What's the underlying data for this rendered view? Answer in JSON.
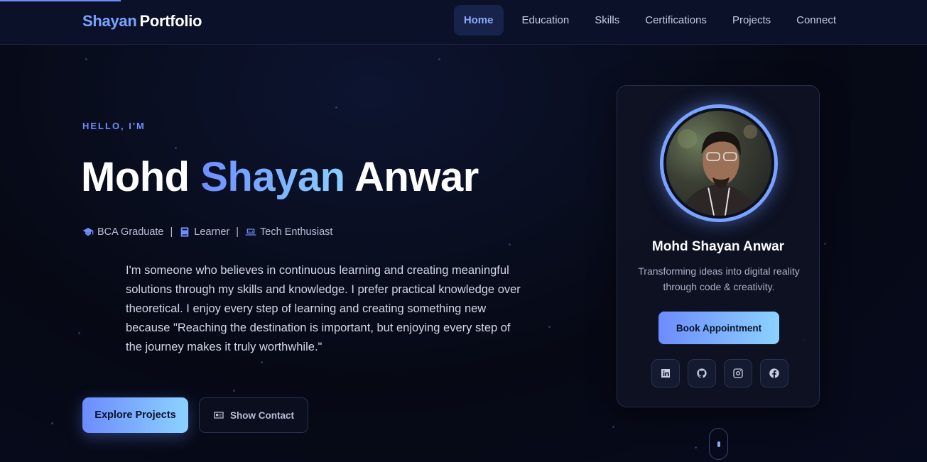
{
  "nav": {
    "logo_first": "Shayan",
    "logo_second": "Portfolio",
    "links": [
      "Home",
      "Education",
      "Skills",
      "Certifications",
      "Projects",
      "Connect"
    ],
    "active": "Home"
  },
  "hero": {
    "greeting": "HELLO, I'M",
    "name_first": "Mohd",
    "name_middle": "Shayan",
    "name_last": "Anwar",
    "tags": [
      {
        "icon": "graduation-cap-icon",
        "label": "BCA Graduate"
      },
      {
        "icon": "book-icon",
        "label": "Learner"
      },
      {
        "icon": "laptop-icon",
        "label": "Tech Enthusiast"
      }
    ],
    "separator": "|",
    "bio": "I'm someone who believes in continuous learning and creating meaningful solutions through my skills and knowledge. I prefer practical knowledge over theoretical. I enjoy every step of learning and creating something new because \"Reaching the destination is important, but enjoying every step of the journey makes it truly worthwhile.\"",
    "explore_label": "Explore Projects",
    "contact_label": "Show Contact"
  },
  "card": {
    "name": "Mohd Shayan Anwar",
    "tagline": "Transforming ideas into digital reality through code & creativity.",
    "book_label": "Book Appointment",
    "socials": [
      "linkedin-icon",
      "github-icon",
      "instagram-icon",
      "facebook-icon"
    ]
  },
  "colors": {
    "accent": "#6f8dff",
    "accent_light": "#8ad0ff",
    "background": "#060914"
  }
}
